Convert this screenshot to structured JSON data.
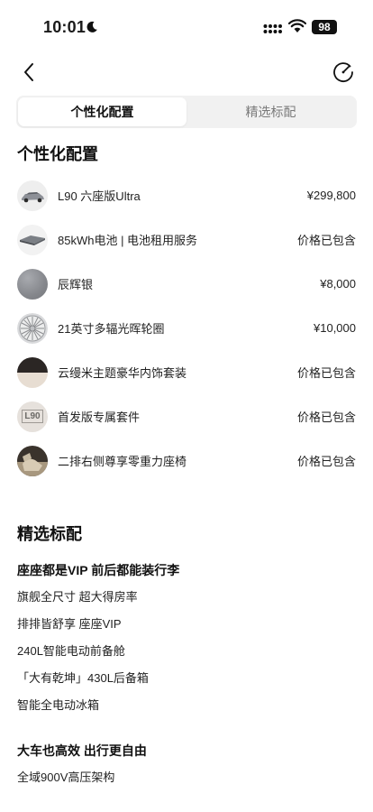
{
  "status": {
    "time": "10:01",
    "battery": "98"
  },
  "tabs": [
    {
      "label": "个性化配置",
      "active": true
    },
    {
      "label": "精选标配",
      "active": false
    }
  ],
  "personal": {
    "title": "个性化配置",
    "items": [
      {
        "name": "L90 六座版Ultra",
        "price": "¥299,800",
        "icon": "car-thumbnail"
      },
      {
        "name": "85kWh电池 | 电池租用服务",
        "price": "价格已包含",
        "icon": "battery-pack-thumbnail"
      },
      {
        "name": "辰辉银",
        "price": "¥8,000",
        "icon": "silver-paint-swatch",
        "color": "#8f9196"
      },
      {
        "name": "21英寸多辐光晖轮圈",
        "price": "¥10,000",
        "icon": "wheel-rim-thumbnail"
      },
      {
        "name": "云缦米主题豪华内饰套装",
        "price": "价格已包含",
        "icon": "interior-swatch"
      },
      {
        "name": "首发版专属套件",
        "price": "价格已包含",
        "icon": "badge-thumbnail",
        "badge_text": "L90"
      },
      {
        "name": "二排右侧尊享零重力座椅",
        "price": "价格已包含",
        "icon": "seat-thumbnail"
      }
    ]
  },
  "standard": {
    "title": "精选标配",
    "groups": [
      {
        "heading": "座座都是VIP 前后都能装行李",
        "lines": [
          "旗舰全尺寸 超大得房率",
          "排排皆舒享 座座VIP",
          "240L智能电动前备舱",
          "「大有乾坤」430L后备箱",
          "智能全电动冰箱"
        ]
      },
      {
        "heading": "大车也高效 出行更自由",
        "lines": [
          "全域900V高压架构"
        ]
      }
    ]
  }
}
